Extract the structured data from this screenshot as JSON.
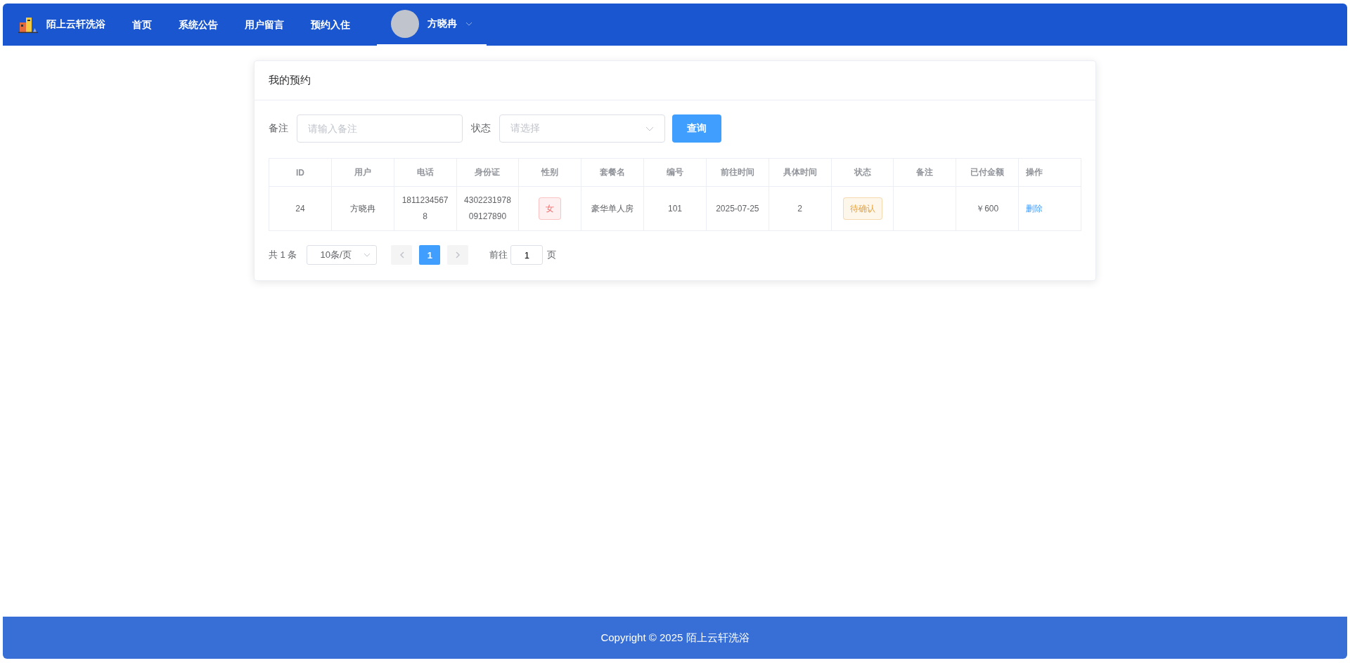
{
  "header": {
    "brand": "陌上云轩洗浴",
    "nav": [
      {
        "label": "首页",
        "selected": false
      },
      {
        "label": "系统公告",
        "selected": false
      },
      {
        "label": "用户留言",
        "selected": false
      },
      {
        "label": "预约入住",
        "selected": false
      }
    ],
    "user": {
      "name": "方晓冉",
      "selected": true
    }
  },
  "card": {
    "title": "我的预约",
    "filters": [
      {
        "kind": "input",
        "label": "备注",
        "placeholder": "请输入备注"
      },
      {
        "kind": "select",
        "label": "状态",
        "placeholder": "请选择"
      }
    ],
    "search_button": "查询",
    "table": {
      "columns": [
        "ID",
        "用户",
        "电话",
        "身份证",
        "性别",
        "套餐名",
        "编号",
        "前往时间",
        "具体时间",
        "状态",
        "备注",
        "已付金额",
        "操作"
      ],
      "rows": [
        {
          "cells": [
            {
              "kind": "text",
              "text": "24"
            },
            {
              "kind": "text",
              "text": "方晓冉"
            },
            {
              "kind": "text",
              "text": "18112345678"
            },
            {
              "kind": "text",
              "text": "430223197809127890"
            },
            {
              "kind": "tag",
              "text": "女",
              "color": "#f56c6c"
            },
            {
              "kind": "text",
              "text": "豪华单人房"
            },
            {
              "kind": "text",
              "text": "101"
            },
            {
              "kind": "text",
              "text": "2025-07-25"
            },
            {
              "kind": "text",
              "text": "2"
            },
            {
              "kind": "tag",
              "text": "待确认",
              "color": "#e6a23c"
            },
            {
              "kind": "empty"
            },
            {
              "kind": "text",
              "text": "￥600"
            },
            {
              "kind": "link",
              "text": "删除"
            }
          ]
        }
      ]
    },
    "pagination": {
      "total": "共 1 条",
      "page_size": "10条/页",
      "pages": [
        {
          "label": "1",
          "selected": true
        }
      ],
      "goto_label": "前往",
      "goto_value": "1",
      "goto_suffix": "页"
    }
  },
  "footer": "Copyright © 2025 陌上云轩洗浴"
}
